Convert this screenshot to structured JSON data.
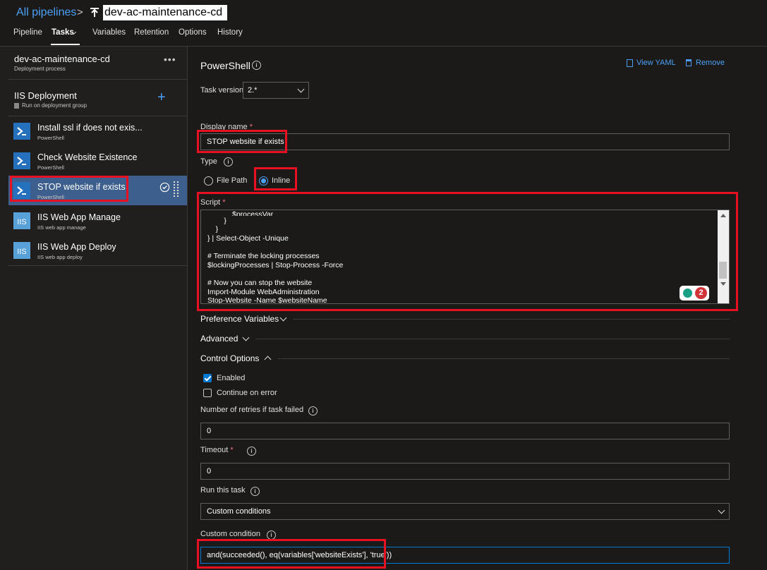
{
  "header": {
    "breadcrumb_root": "All pipelines",
    "separator": ">",
    "pipeline_name": "dev-ac-maintenance-cd"
  },
  "tabs": [
    "Pipeline",
    "Tasks",
    "Variables",
    "Retention",
    "Options",
    "History"
  ],
  "left": {
    "process_title": "dev-ac-maintenance-cd",
    "process_subtitle": "Deployment process",
    "more": "•••",
    "phase_title": "IIS Deployment",
    "phase_subtitle": "Run on deployment group",
    "add": "+",
    "tasks": [
      {
        "title": "Install ssl if does not exis...",
        "subtitle": "PowerShell",
        "icon": "powershell-icon"
      },
      {
        "title": "Check Website Existence",
        "subtitle": "PowerShell",
        "icon": "powershell-icon"
      },
      {
        "title": "STOP website if exists",
        "subtitle": "PowerShell",
        "icon": "powershell-icon"
      },
      {
        "title": "IIS Web App Manage",
        "subtitle": "IIS web app manage",
        "icon": "iis-icon"
      },
      {
        "title": "IIS Web App Deploy",
        "subtitle": "IIS web app deploy",
        "icon": "iis-icon"
      }
    ]
  },
  "right": {
    "task_title": "PowerShell",
    "view_yaml": "View YAML",
    "remove": "Remove",
    "task_version_label": "Task version",
    "task_version_value": "2.*",
    "display_name_label": "Display name",
    "required": "*",
    "display_name_value": "STOP website if exists",
    "type_label": "Type",
    "type_option_file": "File Path",
    "type_option_inline": "Inline",
    "script_label": "Script",
    "script_lines": [
      "            $processVar",
      "        }",
      "    }",
      "} | Select-Object -Unique",
      "",
      "# Terminate the locking processes",
      "$lockingProcesses | Stop-Process -Force",
      "",
      "# Now you can stop the website",
      "Import-Module WebAdministration",
      "Stop-Website -Name $websiteName"
    ],
    "extension_badge_count": "2",
    "preference_variables": "Preference Variables",
    "advanced": "Advanced",
    "control_options": "Control Options",
    "enabled_label": "Enabled",
    "continue_on_error_label": "Continue on error",
    "retries_label": "Number of retries if task failed",
    "retries_value": "0",
    "timeout_label": "Timeout",
    "timeout_value": "0",
    "run_task_label": "Run this task",
    "run_task_value": "Custom conditions",
    "custom_condition_label": "Custom condition",
    "custom_condition_value": "and(succeeded(), eq(variables['websiteExists'], 'true'))"
  }
}
